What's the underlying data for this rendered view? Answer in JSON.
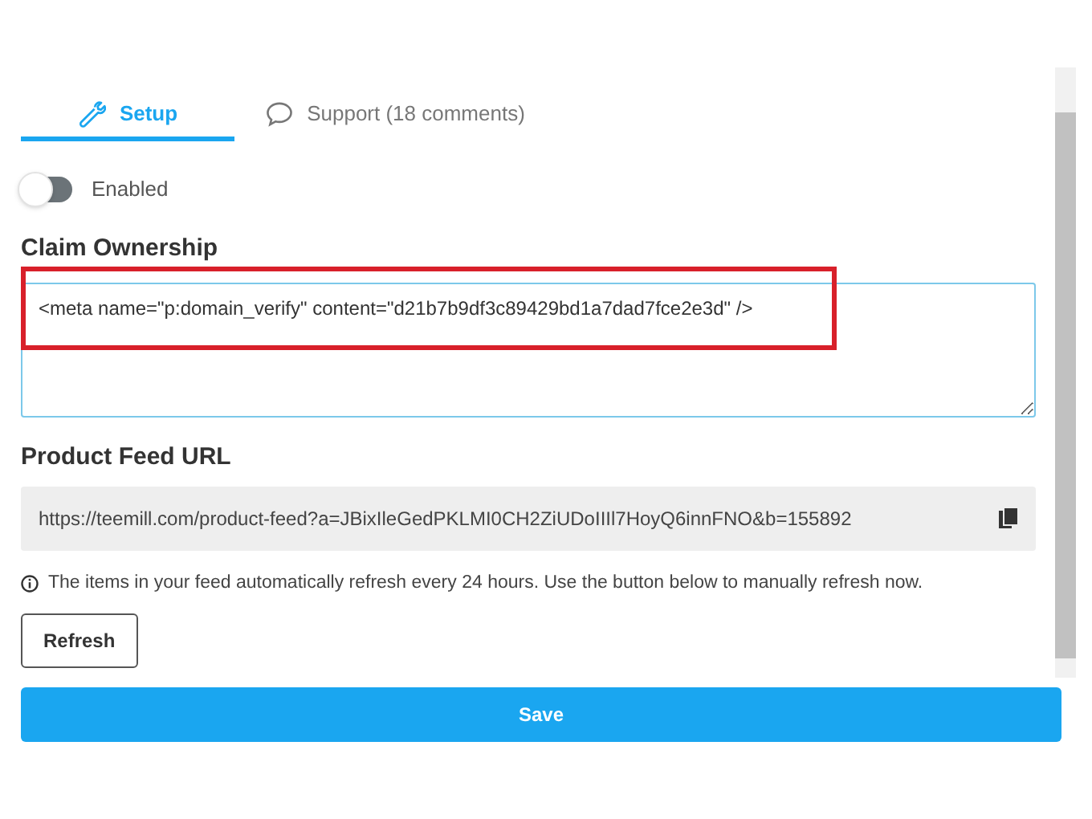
{
  "tabs": [
    {
      "label": "Setup",
      "selected": true
    },
    {
      "label": "Support (18 comments)",
      "selected": false
    }
  ],
  "toggle": {
    "label": "Enabled",
    "on": false
  },
  "claim": {
    "title": "Claim Ownership",
    "value": "<meta name=\"p:domain_verify\" content=\"d21b7b9df3c89429bd1a7dad7fce2e3d\" />",
    "highlighted": true
  },
  "feed": {
    "title": "Product Feed URL",
    "url": "https://teemill.com/product-feed?a=JBixIleGedPKLMI0CH2ZiUDoIIIl7HoyQ6innFNO&b=155892"
  },
  "info": "The items in your feed automatically refresh every 24 hours. Use the button below to manually refresh now.",
  "refresh_button": "Refresh",
  "save_button": "Save"
}
